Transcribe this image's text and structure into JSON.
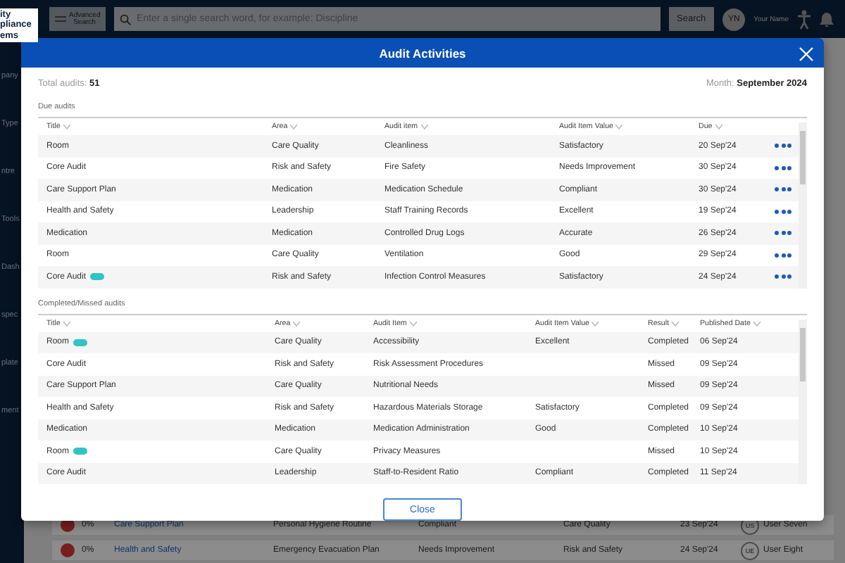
{
  "topbar": {
    "logo_lines": [
      "ity",
      "pliance",
      "ems"
    ],
    "advanced_search": "Advanced Search",
    "search_placeholder": "Enter a single search word, for example: Discipline",
    "search_button": "Search",
    "avatar": "YN",
    "user_name": "Your Name"
  },
  "sidebar": {
    "items": [
      "pany",
      "Type",
      "ntre",
      "Tools",
      "Dash",
      "spec",
      "plate",
      "ment"
    ]
  },
  "background_rows": [
    {
      "percent": "0%",
      "title": "Care Support Plan",
      "item": "Personal Hygiene Routine",
      "value": "Compliant",
      "area": "Care Quality",
      "date": "23 Sep'24",
      "avatar": "US",
      "user": "User Seven"
    },
    {
      "percent": "0%",
      "title": "Health and Safety",
      "item": "Emergency Evacuation Plan",
      "value": "Needs Improvement",
      "area": "Risk and Safety",
      "date": "24 Sep'24",
      "avatar": "UE",
      "user": "User Eight"
    }
  ],
  "modal": {
    "title": "Audit Activities",
    "total_label": "Total audits:",
    "total": "51",
    "month_label": "Month:",
    "month": "September 2024",
    "due": {
      "heading": "Due audits",
      "columns": [
        "Title",
        "Area",
        "Audit item",
        "Audit Item Value",
        "Due"
      ],
      "rows": [
        {
          "title": "Room",
          "tagged": false,
          "area": "Care Quality",
          "item": "Cleanliness",
          "value": "Satisfactory",
          "due": "20 Sep'24"
        },
        {
          "title": "Core Audit",
          "tagged": false,
          "area": "Risk and Safety",
          "item": "Fire Safety",
          "value": "Needs Improvement",
          "due": "30 Sep'24"
        },
        {
          "title": "Care Support Plan",
          "tagged": false,
          "area": "Medication",
          "item": "Medication Schedule",
          "value": "Compliant",
          "due": "30 Sep'24"
        },
        {
          "title": "Health and Safety",
          "tagged": false,
          "area": "Leadership",
          "item": "Staff Training Records",
          "value": "Excellent",
          "due": "19 Sep'24"
        },
        {
          "title": "Medication",
          "tagged": false,
          "area": "Medication",
          "item": "Controlled Drug Logs",
          "value": "Accurate",
          "due": "26 Sep'24"
        },
        {
          "title": "Room",
          "tagged": false,
          "area": "Care Quality",
          "item": "Ventilation",
          "value": "Good",
          "due": "29 Sep'24"
        },
        {
          "title": "Core Audit",
          "tagged": true,
          "area": "Risk and Safety",
          "item": "Infection Control Measures",
          "value": "Satisfactory",
          "due": "24 Sep'24"
        }
      ]
    },
    "completed": {
      "heading": "Completed/Missed audits",
      "columns": [
        "Title",
        "Area",
        "Audit Item",
        "Audit Item Value",
        "Result",
        "Published Date"
      ],
      "rows": [
        {
          "title": "Room",
          "tagged": true,
          "area": "Care Quality",
          "item": "Accessibility",
          "value": "Excellent",
          "result": "Completed",
          "published": "06 Sep'24"
        },
        {
          "title": "Core Audit",
          "tagged": false,
          "area": "Risk and Safety",
          "item": "Risk Assessment Procedures",
          "value": "",
          "result": "Missed",
          "published": "09 Sep'24"
        },
        {
          "title": "Care Support Plan",
          "tagged": false,
          "area": "Care Quality",
          "item": "Nutritional Needs",
          "value": "",
          "result": "Missed",
          "published": "09 Sep'24"
        },
        {
          "title": "Health and Safety",
          "tagged": false,
          "area": "Risk and Safety",
          "item": "Hazardous Materials Storage",
          "value": "Satisfactory",
          "result": "Completed",
          "published": "09 Sep'24"
        },
        {
          "title": "Medication",
          "tagged": false,
          "area": "Medication",
          "item": "Medication Administration",
          "value": "Good",
          "result": "Completed",
          "published": "10 Sep'24"
        },
        {
          "title": "Room",
          "tagged": true,
          "area": "Care Quality",
          "item": "Privacy Measures",
          "value": "",
          "result": "Missed",
          "published": "10 Sep'24"
        },
        {
          "title": "Core Audit",
          "tagged": false,
          "area": "Leadership",
          "item": "Staff-to-Resident Ratio",
          "value": "Compliant",
          "result": "Completed",
          "published": "11 Sep'24"
        }
      ]
    },
    "close_button": "Close"
  }
}
